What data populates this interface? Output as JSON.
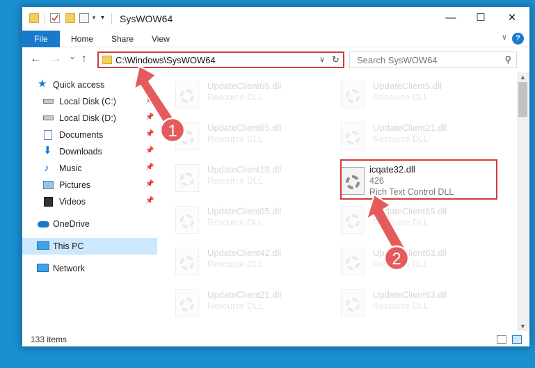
{
  "window": {
    "title": "SysWOW64",
    "minimize": "—",
    "maximize": "☐",
    "close": "✕"
  },
  "ribbon": {
    "tabs": [
      "File",
      "Home",
      "Share",
      "View"
    ],
    "help": "?"
  },
  "navigation": {
    "back": "←",
    "forward": "→",
    "recent": "⌄",
    "up": "↑",
    "address": "C:\\Windows\\SysWOW64",
    "search_placeholder": "Search SysWOW64"
  },
  "sidebar": {
    "items": [
      {
        "label": "Quick access",
        "icon": "star-icon"
      },
      {
        "label": "Local Disk (C:)",
        "icon": "drive-icon",
        "pinned": true
      },
      {
        "label": "Local Disk (D:)",
        "icon": "drive-icon",
        "pinned": true
      },
      {
        "label": "Documents",
        "icon": "documents-icon",
        "pinned": true
      },
      {
        "label": "Downloads",
        "icon": "download-icon",
        "pinned": true
      },
      {
        "label": "Music",
        "icon": "music-icon",
        "pinned": true
      },
      {
        "label": "Pictures",
        "icon": "pictures-icon",
        "pinned": true
      },
      {
        "label": "Videos",
        "icon": "videos-icon",
        "pinned": true
      },
      {
        "label": "OneDrive",
        "icon": "cloud-icon"
      },
      {
        "label": "This PC",
        "icon": "computer-icon",
        "selected": true
      },
      {
        "label": "Network",
        "icon": "network-icon"
      }
    ]
  },
  "files": {
    "left_column": [
      {
        "name": "UpdateClient65.dll",
        "type": "Resource DLL"
      },
      {
        "name": "UpdateClient65.dll",
        "type": "Resource DLL"
      },
      {
        "name": "UpdateClient19.dll",
        "type": "Resource DLL"
      },
      {
        "name": "UpdateClient65.dll",
        "type": "Resource DLL"
      },
      {
        "name": "UpdateClient42.dll",
        "type": "Resource DLL"
      },
      {
        "name": "UpdateClient21.dll",
        "type": "Resource DLL"
      }
    ],
    "right_column": [
      {
        "name": "UpdateClient5.dll",
        "type": "Resource DLL"
      },
      {
        "name": "UpdateClient21.dll",
        "type": "Resource DLL"
      },
      {
        "name": "icqate32.dll",
        "size": "426",
        "type": "Rich Text Control DLL",
        "highlighted": true
      },
      {
        "name": "UpdateClient65.dll",
        "type": "Resource DLL"
      },
      {
        "name": "UpdateClient63.dll",
        "type": "Resource DLL"
      },
      {
        "name": "UpdateClient63.dll",
        "type": "Resource DLL"
      }
    ]
  },
  "status": {
    "item_count": "133 items"
  },
  "annotations": {
    "step1": "1",
    "step2": "2",
    "color": "#d23b3b"
  }
}
